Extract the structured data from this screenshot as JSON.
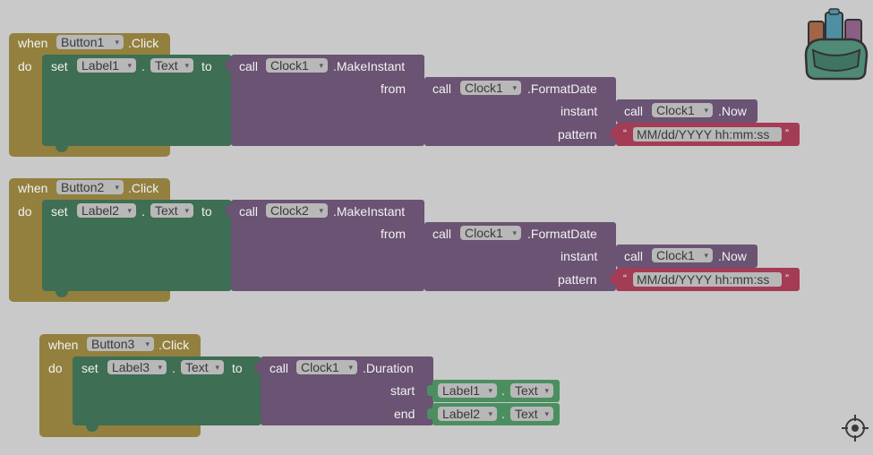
{
  "colors": {
    "workspace": "#c9c9c9",
    "event_block": "#93803e",
    "set_block": "#3e6e53",
    "call_block": "#6a5373",
    "text_block": "#a33c54",
    "get_block": "#4b8f60"
  },
  "blocks": [
    {
      "when": "when",
      "component": "Button1",
      "event": ".Click",
      "do": "do",
      "set": "set",
      "set_component": "Label1",
      "dot": ".",
      "property": "Text",
      "to": "to",
      "call": "call",
      "clock": "Clock1",
      "method": ".MakeInstant",
      "from_label": "from",
      "inner_call": "call",
      "inner_clock": "Clock1",
      "inner_method": ".FormatDate",
      "instant_label": "instant",
      "now_call": "call",
      "now_clock": "Clock1",
      "now_method": ".Now",
      "pattern_label": "pattern",
      "quote_open": "“",
      "pattern": "MM/dd/YYYY hh:mm:ss",
      "quote_close": "”"
    },
    {
      "when": "when",
      "component": "Button2",
      "event": ".Click",
      "do": "do",
      "set": "set",
      "set_component": "Label2",
      "dot": ".",
      "property": "Text",
      "to": "to",
      "call": "call",
      "clock": "Clock2",
      "method": ".MakeInstant",
      "from_label": "from",
      "inner_call": "call",
      "inner_clock": "Clock1",
      "inner_method": ".FormatDate",
      "instant_label": "instant",
      "now_call": "call",
      "now_clock": "Clock1",
      "now_method": ".Now",
      "pattern_label": "pattern",
      "quote_open": "“",
      "pattern": "MM/dd/YYYY hh:mm:ss",
      "quote_close": "”"
    },
    {
      "when": "when",
      "component": "Button3",
      "event": ".Click",
      "do": "do",
      "set": "set",
      "set_component": "Label3",
      "dot": ".",
      "property": "Text",
      "to": "to",
      "call": "call",
      "clock": "Clock1",
      "method": ".Duration",
      "start_label": "start",
      "start_component": "Label1",
      "start_dot": ".",
      "start_property": "Text",
      "end_label": "end",
      "end_component": "Label2",
      "end_dot": ".",
      "end_property": "Text"
    }
  ],
  "icons": {
    "backpack": "backpack-icon",
    "workspace_center": "crosshair-target-icon",
    "dropdown_caret": "▾"
  }
}
